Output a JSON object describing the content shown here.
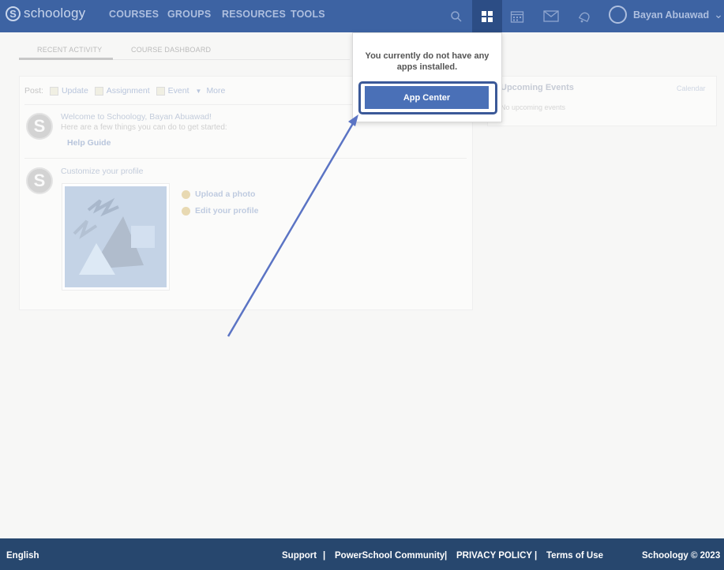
{
  "nav": {
    "logo_letter": "S",
    "logo_text": "schoology",
    "links": [
      "COURSES",
      "GROUPS",
      "RESOURCES",
      "TOOLS"
    ],
    "icons": [
      "search-icon",
      "apps-grid-icon",
      "calendar-icon",
      "mail-icon",
      "notifications-icon"
    ],
    "user_name": "Bayan Abuawad"
  },
  "tabs": [
    "RECENT ACTIVITY",
    "COURSE DASHBOARD"
  ],
  "post_bar": {
    "label": "Post:",
    "items": [
      "Update",
      "Assignment",
      "Event",
      "More"
    ]
  },
  "feed": {
    "welcome_title": "Welcome to Schoology, Bayan Abuawad!",
    "welcome_sub": "Here are a few things you can do to get started:",
    "help_guide": "Help Guide",
    "customize_title": "Customize your profile",
    "upload_photo": "Upload a photo",
    "edit_profile": "Edit your profile",
    "avatar_letter": "S"
  },
  "events": {
    "title": "Upcoming Events",
    "calendar_link": "Calendar",
    "empty": "No upcoming events"
  },
  "apps_dropdown": {
    "message": "You currently do not have any apps installed.",
    "button": "App Center"
  },
  "footer": {
    "language": "English",
    "support": "Support",
    "community": "PowerSchool Community",
    "privacy": "PRIVACY POLICY",
    "terms": "Terms of Use",
    "copyright": "Schoology © 2023",
    "separator": "|"
  },
  "colors": {
    "nav_bg": "#3d63a3",
    "footer_bg": "#27476e",
    "accent": "#4a70b7",
    "highlight_border": "#3b5998",
    "arrow": "#5b74c4"
  }
}
